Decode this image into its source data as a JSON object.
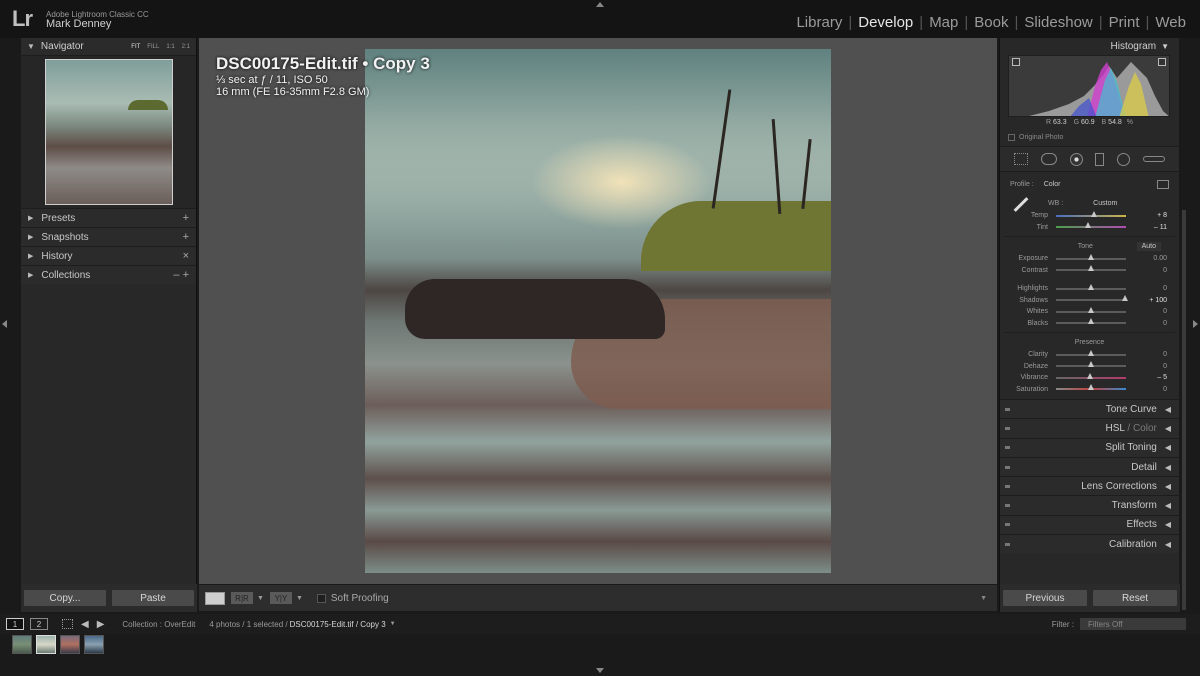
{
  "app": {
    "logo": "Lr",
    "name": "Adobe Lightroom Classic CC",
    "user": "Mark Denney",
    "modules": [
      "Library",
      "Develop",
      "Map",
      "Book",
      "Slideshow",
      "Print",
      "Web"
    ],
    "active_module": "Develop"
  },
  "navigator": {
    "title": "Navigator",
    "zoom_options": [
      "FIT",
      "FILL",
      "1:1",
      "2:1"
    ],
    "selected_zoom": "FIT"
  },
  "left_sections": [
    {
      "label": "Presets",
      "action": "+"
    },
    {
      "label": "Snapshots",
      "action": "+"
    },
    {
      "label": "History",
      "action": "×"
    },
    {
      "label": "Collections",
      "action": "–  +"
    }
  ],
  "left_buttons": {
    "copy": "Copy...",
    "paste": "Paste"
  },
  "photo": {
    "title": "DSC00175-Edit.tif  •  Copy 3",
    "exposure": "⅓ sec at ƒ / 11, ISO 50",
    "lens": "16 mm (FE 16-35mm F2.8 GM)"
  },
  "toolbar": {
    "soft_proofing": "Soft Proofing"
  },
  "histogram": {
    "title": "Histogram",
    "readout": {
      "r_label": "R",
      "r": "63.3",
      "g_label": "G",
      "g": "60.9",
      "b_label": "B",
      "b": "54.8",
      "unit": "%"
    },
    "original_photo": "Original Photo"
  },
  "basic": {
    "profile_label": "Profile :",
    "profile_value": "Color",
    "wb_label": "WB :",
    "wb_value": "Custom",
    "tone_label": "Tone",
    "auto_label": "Auto",
    "presence_label": "Presence",
    "sliders": {
      "temp": {
        "label": "Temp",
        "value": "+ 8",
        "pos": 0.54
      },
      "tint": {
        "label": "Tint",
        "value": "– 11",
        "pos": 0.45
      },
      "exposure": {
        "label": "Exposure",
        "value": "0.00",
        "pos": 0.5
      },
      "contrast": {
        "label": "Contrast",
        "value": "0",
        "pos": 0.5
      },
      "highlights": {
        "label": "Highlights",
        "value": "0",
        "pos": 0.5
      },
      "shadows": {
        "label": "Shadows",
        "value": "+ 100",
        "pos": 0.98
      },
      "whites": {
        "label": "Whites",
        "value": "0",
        "pos": 0.5
      },
      "blacks": {
        "label": "Blacks",
        "value": "0",
        "pos": 0.5
      },
      "clarity": {
        "label": "Clarity",
        "value": "0",
        "pos": 0.5
      },
      "dehaze": {
        "label": "Dehaze",
        "value": "0",
        "pos": 0.5
      },
      "vibrance": {
        "label": "Vibrance",
        "value": "– 5",
        "pos": 0.48
      },
      "saturation": {
        "label": "Saturation",
        "value": "0",
        "pos": 0.5
      }
    }
  },
  "right_sections": {
    "tone_curve": "Tone Curve",
    "hsl": "HSL",
    "hsl_sep": " / ",
    "color": "Color",
    "split_toning": "Split Toning",
    "detail": "Detail",
    "lens_corrections": "Lens Corrections",
    "transform": "Transform",
    "effects": "Effects",
    "calibration": "Calibration"
  },
  "right_buttons": {
    "previous": "Previous",
    "reset": "Reset"
  },
  "filmstrip": {
    "page1": "1",
    "page2": "2",
    "collection": "Collection : OverEdit",
    "count": "4 photos / 1 selected /",
    "path": "DSC00175-Edit.tif / Copy 3",
    "filter_label": "Filter :",
    "filter_value": "Filters Off"
  }
}
